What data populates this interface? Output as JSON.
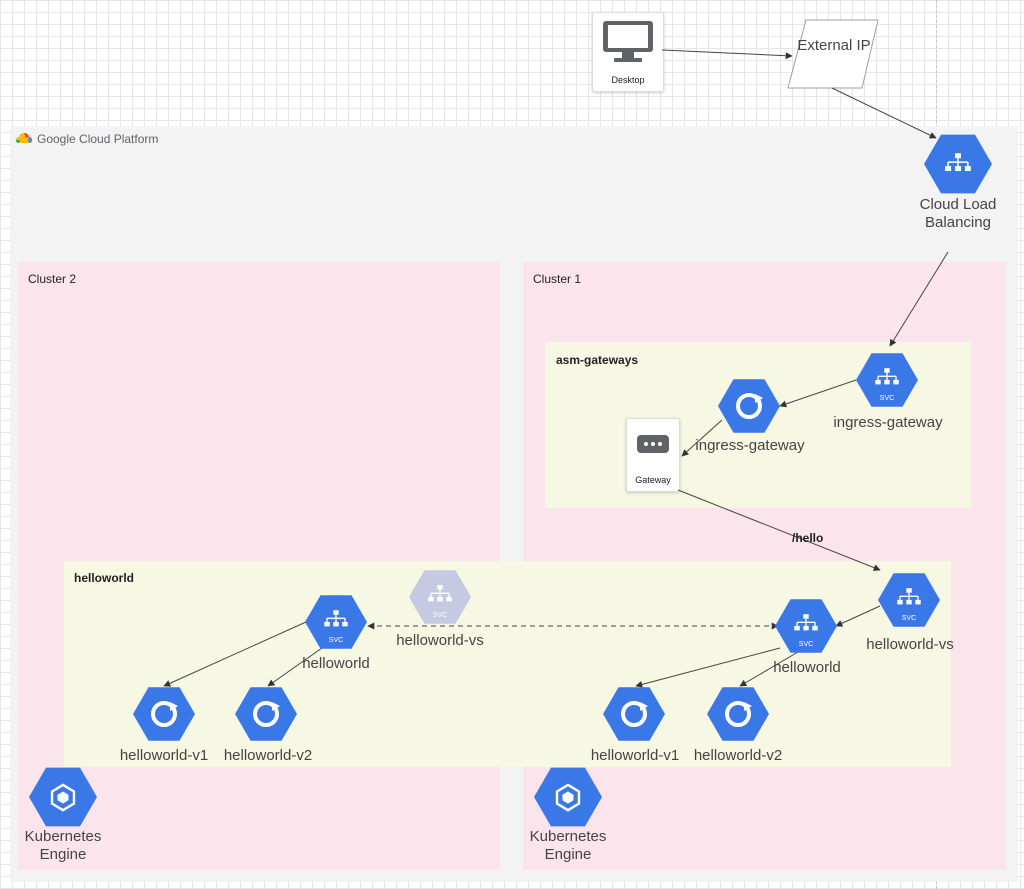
{
  "platform": {
    "label": "Google Cloud Platform"
  },
  "colors": {
    "gcp_blue": "#3b78e7",
    "cluster_fill": "#fce4ec",
    "zone_fill": "#f6f8e3",
    "ghost_gray": "#c5cae2"
  },
  "nodes": {
    "desktop": {
      "label": "Desktop",
      "icon": "desktop-icon"
    },
    "external_ip": {
      "label": "External IP"
    },
    "cloud_lb": {
      "label": "Cloud Load Balancing",
      "icon": "load-balancing-icon"
    },
    "gateway_resource": {
      "label": "Gateway",
      "icon": "gateway-icon"
    },
    "ingress_gateway_svc": {
      "label": "ingress-gateway",
      "badge": "SVC"
    },
    "ingress_gateway_pod": {
      "label": "ingress-gateway"
    },
    "c1_helloworld_vs": {
      "label": "helloworld-vs",
      "badge": "SVC"
    },
    "c1_helloworld_svc": {
      "label": "helloworld",
      "badge": "SVC"
    },
    "c1_helloworld_v1": {
      "label": "helloworld-v1"
    },
    "c1_helloworld_v2": {
      "label": "helloworld-v2"
    },
    "c2_helloworld_vs": {
      "label": "helloworld-vs",
      "badge": "SVC"
    },
    "c2_helloworld_svc": {
      "label": "helloworld",
      "badge": "SVC"
    },
    "c2_helloworld_v1": {
      "label": "helloworld-v1"
    },
    "c2_helloworld_v2": {
      "label": "helloworld-v2"
    },
    "c1_gke": {
      "label": "Kubernetes Engine"
    },
    "c2_gke": {
      "label": "Kubernetes Engine"
    }
  },
  "boxes": {
    "cluster2": "Cluster 2",
    "cluster1": "Cluster 1",
    "asm_gateways": "asm-gateways",
    "helloworld_ns": "helloworld"
  },
  "edges": {
    "route_label": "/hello"
  }
}
